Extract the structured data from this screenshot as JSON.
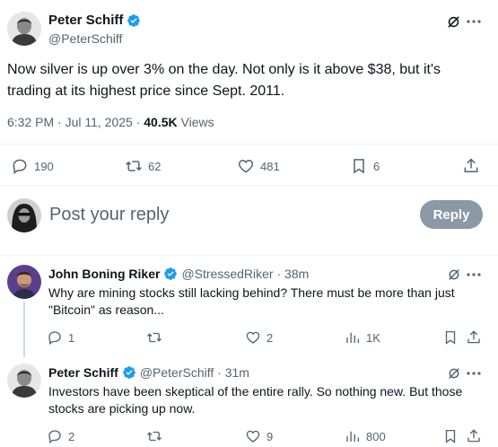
{
  "main_tweet": {
    "author_name": "Peter Schiff",
    "author_handle": "@PeterSchiff",
    "text_line1": "Now silver is up over 3% on the day. Not only is it above $38, but it's",
    "text_line2": "trading at its highest price since Sept. 2011.",
    "timestamp": "6:32 PM · Jul 11, 2025 · ",
    "views_count": "40.5K",
    "views_label": " Views",
    "stats": {
      "replies": "190",
      "reposts": "62",
      "likes": "481",
      "bookmarks": "6"
    }
  },
  "composer": {
    "placeholder": "Post your reply",
    "reply_button": "Reply"
  },
  "replies": [
    {
      "author_name": "John Boning Riker",
      "author_handle": "@StressedRiker",
      "time": " · 38m",
      "text_line1": "Why are mining stocks still lacking behind? There must be more than just",
      "text_line2": "\"Bitcoin\" as reason...",
      "stats": {
        "replies": "1",
        "reposts": "",
        "likes": "2",
        "views": "1K"
      }
    },
    {
      "author_name": "Peter Schiff",
      "author_handle": "@PeterSchiff",
      "time": " · 31m",
      "text_line1": "Investors have been skeptical of the entire rally. So nothing new. But those",
      "text_line2": "stocks are picking up now.",
      "stats": {
        "replies": "2",
        "reposts": "",
        "likes": "9",
        "views": "800"
      }
    }
  ],
  "colors": {
    "verified": "#1d9bf0",
    "muted": "#536471",
    "reply_button_disabled": "#8b98a5"
  },
  "icons": [
    "grok-icon",
    "more-icon",
    "reply-icon",
    "repost-icon",
    "like-icon",
    "bookmark-icon",
    "share-icon",
    "views-icon",
    "verified-badge-icon"
  ]
}
